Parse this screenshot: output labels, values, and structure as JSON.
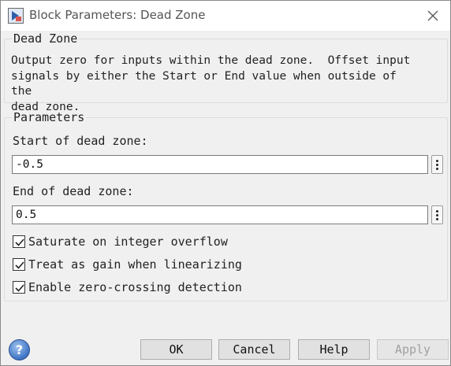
{
  "window": {
    "title": "Block Parameters: Dead Zone"
  },
  "description": {
    "heading": "Dead Zone",
    "text": "Output zero for inputs within the dead zone.  Offset input\nsignals by either the Start or End value when outside of the\ndead zone."
  },
  "parameters": {
    "heading": "Parameters",
    "start": {
      "label": "Start of dead zone:",
      "value": "-0.5"
    },
    "end": {
      "label": "End of dead zone:",
      "value": "0.5"
    },
    "checkboxes": [
      {
        "label": "Saturate on integer overflow",
        "checked": true
      },
      {
        "label": "Treat as gain when linearizing",
        "checked": true
      },
      {
        "label": "Enable zero-crossing detection",
        "checked": true
      }
    ]
  },
  "buttons": {
    "ok": "OK",
    "cancel": "Cancel",
    "help": "Help",
    "apply": "Apply"
  },
  "colors": {
    "help_icon": "#3f74c4",
    "disabled_text": "#a0a0a0"
  },
  "icons": {
    "app": "simulink-block-icon",
    "close": "close-icon",
    "help": "help-icon",
    "check": "checkmark-icon"
  }
}
